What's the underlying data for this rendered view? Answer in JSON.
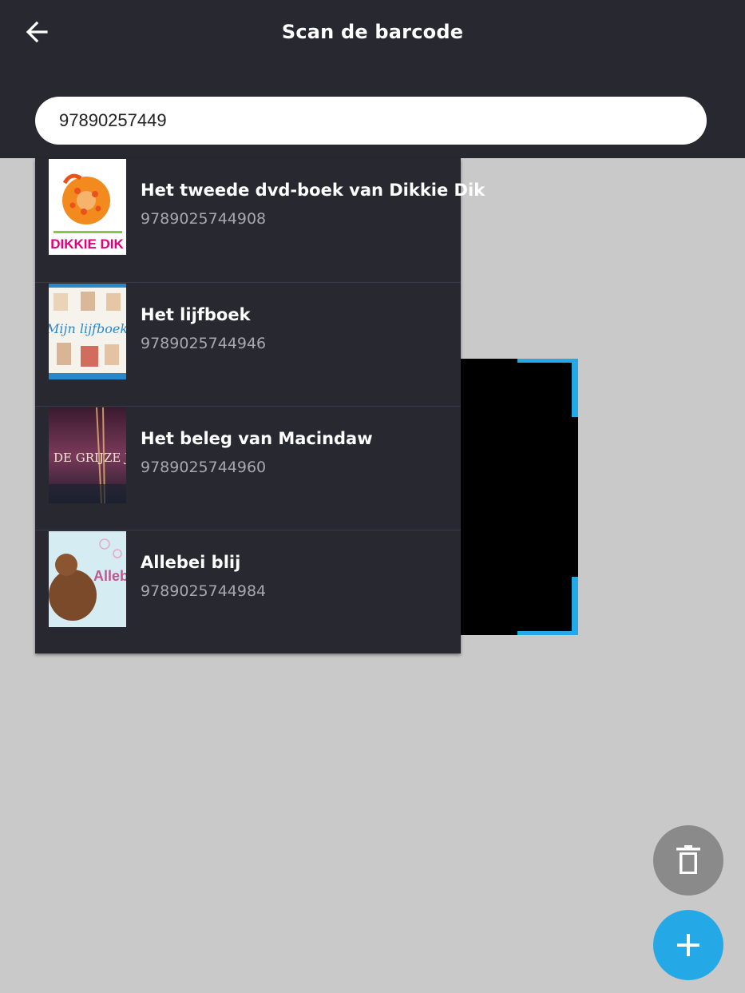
{
  "header": {
    "title": "Scan de barcode",
    "back_icon": "arrow-left-icon",
    "background": "#272830"
  },
  "search": {
    "value": "97890257449"
  },
  "results": [
    {
      "title": "Het tweede dvd-boek van Dikkie Dik",
      "isbn": "9789025744908",
      "cover_text": "DIKKIE DIK"
    },
    {
      "title": "Het lijfboek",
      "isbn": "9789025744946",
      "cover_text": "Mijn lijfboek"
    },
    {
      "title": "Het beleg van Macindaw",
      "isbn": "9789025744960",
      "cover_text": "DE GRIJZE JAGER"
    },
    {
      "title": "Allebei blij",
      "isbn": "9789025744984",
      "cover_text": "Allebei blij"
    }
  ],
  "actions": {
    "delete_icon": "trash-icon",
    "add_icon": "plus-icon",
    "accent": "#25a9e6"
  }
}
